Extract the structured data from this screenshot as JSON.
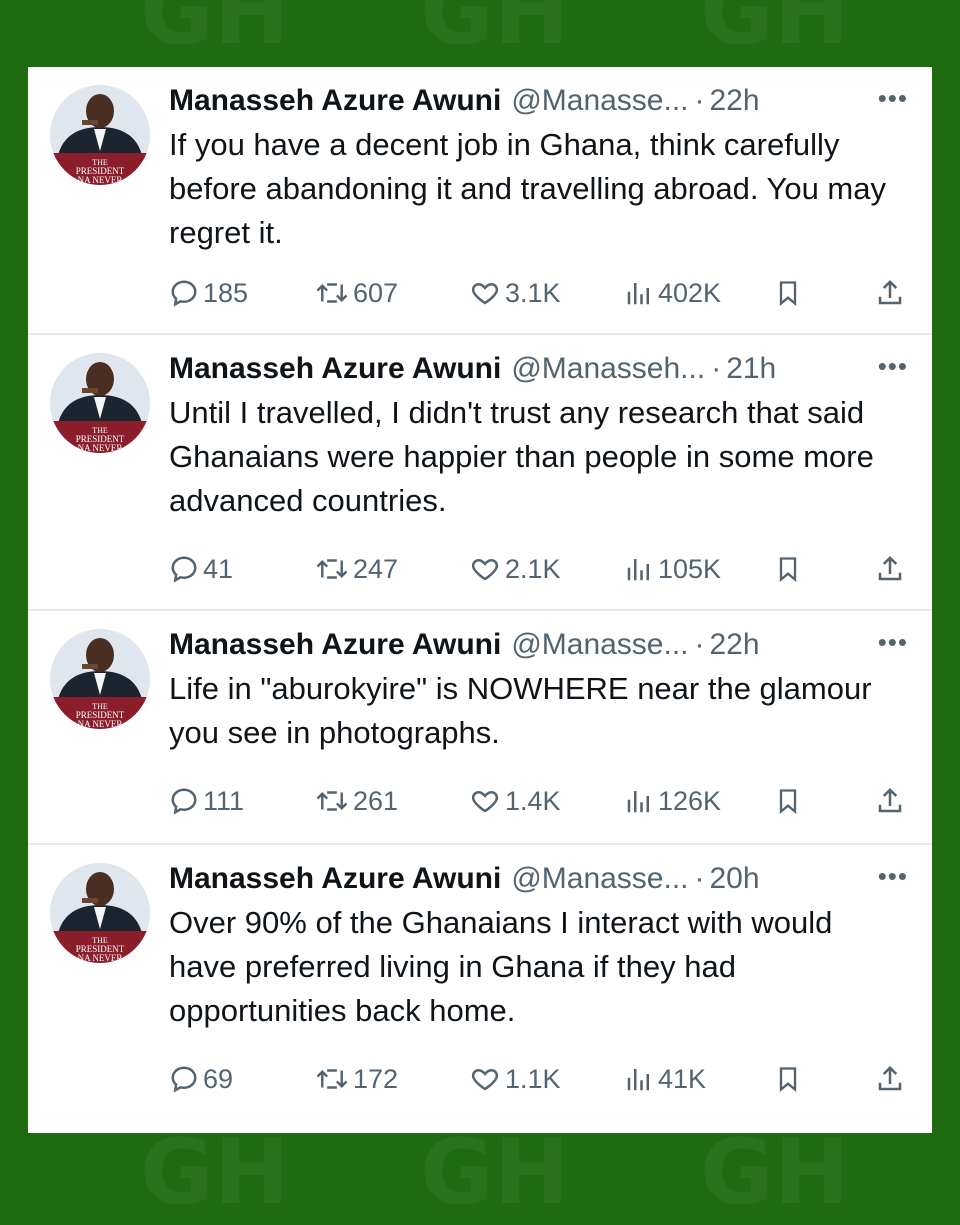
{
  "colors": {
    "background": "#1f6b12",
    "card": "#ffffff",
    "text": "#0f1419",
    "muted": "#536471"
  },
  "avatar_text": [
    "THE",
    "PRESIDENT",
    "NA NEVER"
  ],
  "tweets": [
    {
      "name": "Manasseh Azure Awuni",
      "handle": "@Manasse...",
      "sep": "·",
      "time": "22h",
      "more": "•••",
      "text": "If you have a decent job in Ghana, think carefully before abandoning it and travelling abroad.  You may regret it.",
      "replies": "185",
      "retweets": "607",
      "likes": "3.1K",
      "views": "402K"
    },
    {
      "name": "Manasseh Azure Awuni",
      "handle": "@Manasseh...",
      "sep": "·",
      "time": "21h",
      "more": "•••",
      "text": "Until I travelled, I didn't trust any research that said Ghanaians were happier than people in some more advanced countries.",
      "replies": "41",
      "retweets": "247",
      "likes": "2.1K",
      "views": "105K"
    },
    {
      "name": "Manasseh Azure Awuni",
      "handle": "@Manasse...",
      "sep": "·",
      "time": "22h",
      "more": "•••",
      "text": "Life in \"aburokyire\" is NOWHERE near the glamour you see in photographs.",
      "replies": "111",
      "retweets": "261",
      "likes": "1.4K",
      "views": "126K"
    },
    {
      "name": "Manasseh Azure Awuni",
      "handle": "@Manasse...",
      "sep": "·",
      "time": "20h",
      "more": "•••",
      "text": "Over 90% of the Ghanaians I interact with would have preferred living in Ghana if they had opportunities back home.",
      "replies": "69",
      "retweets": "172",
      "likes": "1.1K",
      "views": "41K"
    }
  ]
}
